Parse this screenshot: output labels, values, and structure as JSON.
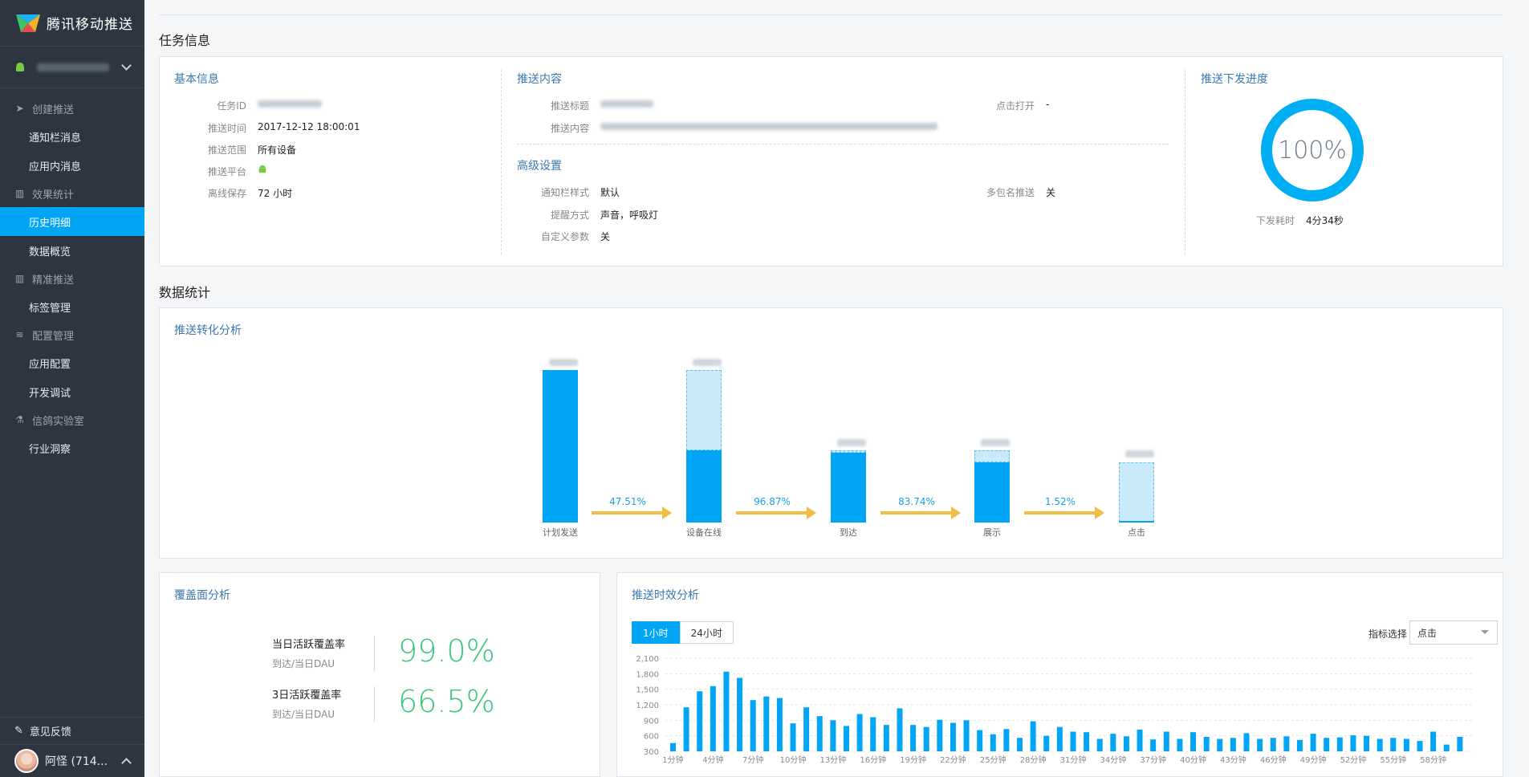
{
  "brand": {
    "name": "腾讯移动推送"
  },
  "sidebar": {
    "groups": [
      {
        "title": "创建推送",
        "icon": "send-icon",
        "items": [
          "通知栏消息",
          "应用内消息"
        ]
      },
      {
        "title": "效果统计",
        "icon": "bar-chart-icon",
        "items": [
          "历史明细",
          "数据概览"
        ]
      },
      {
        "title": "精准推送",
        "icon": "bar-chart-icon",
        "items": [
          "标签管理"
        ]
      },
      {
        "title": "配置管理",
        "icon": "sliders-icon",
        "items": [
          "应用配置",
          "开发调试"
        ]
      },
      {
        "title": "信鸽实验室",
        "icon": "flask-icon",
        "items": [
          "行业洞察"
        ]
      }
    ],
    "active_item": "历史明细",
    "feedback": "意见反馈",
    "user": "阿怪 (714..."
  },
  "task_info": {
    "section_title": "任务信息",
    "basic": {
      "title": "基本信息",
      "rows": [
        {
          "k": "任务ID",
          "v": ""
        },
        {
          "k": "推送时间",
          "v": "2017-12-12 18:00:01"
        },
        {
          "k": "推送范围",
          "v": "所有设备"
        },
        {
          "k": "推送平台",
          "v": ""
        },
        {
          "k": "离线保存",
          "v": "72 小时"
        }
      ]
    },
    "content": {
      "title": "推送内容",
      "title_label": "推送标题",
      "content_label": "推送内容",
      "click_label": "点击打开",
      "click_value": "-"
    },
    "advanced": {
      "title": "高级设置",
      "style_label": "通知栏样式",
      "style_value": "默认",
      "remind_label": "提醒方式",
      "remind_value": "声音，呼吸灯",
      "custom_label": "自定义参数",
      "custom_value": "关",
      "multi_label": "多包名推送",
      "multi_value": "关"
    },
    "progress": {
      "title": "推送下发进度",
      "percent": "100%",
      "time_label": "下发耗时",
      "time_value": "4分34秒"
    }
  },
  "stats": {
    "section_title": "数据统计",
    "funnel": {
      "title": "推送转化分析",
      "stages": [
        "计划发送",
        "设备在线",
        "到达",
        "展示",
        "点击"
      ],
      "rates": [
        "47.51%",
        "96.87%",
        "83.74%",
        "1.52%"
      ]
    },
    "coverage": {
      "title": "覆盖面分析",
      "rows": [
        {
          "label": "当日活跃覆盖率",
          "sub": "到达/当日DAU",
          "value": "99.0%"
        },
        {
          "label": "3日活跃覆盖率",
          "sub": "到达/当日DAU",
          "value": "66.5%"
        }
      ]
    },
    "timing": {
      "title": "推送时效分析",
      "tabs": [
        "1小时",
        "24小时"
      ],
      "active_tab": "1小时",
      "metric_label": "指标选择",
      "metric_value": "点击"
    }
  },
  "chart_data": {
    "type": "bar",
    "color": "#00a6f5",
    "ylim": [
      300,
      2100
    ],
    "yticks": [
      "2,100",
      "1,800",
      "1,500",
      "1,200",
      "900",
      "600",
      "300"
    ],
    "ytick_values": [
      2100,
      1800,
      1500,
      1200,
      900,
      600,
      300
    ],
    "xtick_labels": [
      "1分钟",
      "4分钟",
      "7分钟",
      "10分钟",
      "13分钟",
      "16分钟",
      "19分钟",
      "22分钟",
      "25分钟",
      "28分钟",
      "31分钟",
      "34分钟",
      "37分钟",
      "40分钟",
      "43分钟",
      "46分钟",
      "49分钟",
      "52分钟",
      "55分钟",
      "58分钟"
    ],
    "values": [
      460,
      1150,
      1460,
      1560,
      1840,
      1720,
      1290,
      1360,
      1330,
      840,
      1150,
      980,
      900,
      790,
      1020,
      960,
      810,
      1130,
      810,
      770,
      910,
      850,
      900,
      710,
      630,
      730,
      560,
      880,
      600,
      770,
      680,
      670,
      540,
      640,
      590,
      720,
      530,
      680,
      540,
      670,
      580,
      540,
      560,
      650,
      540,
      560,
      590,
      520,
      640,
      560,
      570,
      610,
      600,
      540,
      560,
      540,
      500,
      680,
      430,
      580
    ]
  }
}
